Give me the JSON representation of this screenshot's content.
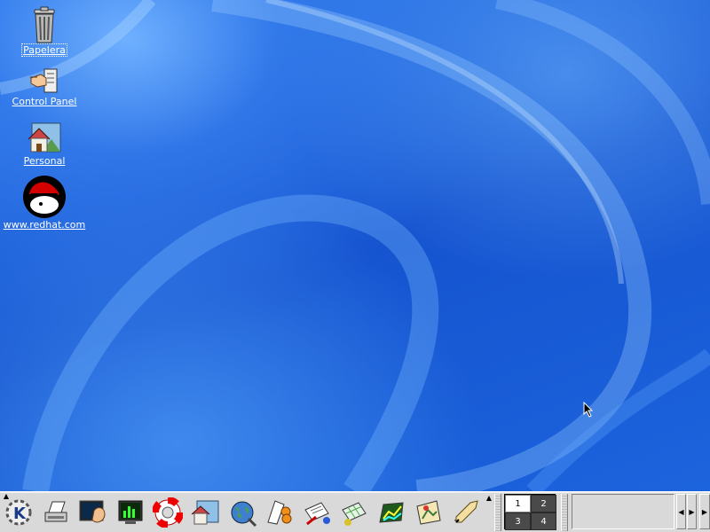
{
  "desktop": {
    "icons": [
      {
        "label": "Papelera",
        "icon": "trash-icon"
      },
      {
        "label": "Control Panel",
        "icon": "control-panel-icon"
      },
      {
        "label": "Personal",
        "icon": "home-folder-icon"
      },
      {
        "label": "www.redhat.com",
        "icon": "redhat-icon"
      }
    ]
  },
  "panel": {
    "launchers": [
      "kde-menu-icon",
      "printer-icon",
      "terminal-icon",
      "system-monitor-icon",
      "help-lifesaver-icon",
      "home-icon",
      "web-browser-icon",
      "mail-icon",
      "document-icon",
      "spreadsheet-icon",
      "chart-icon",
      "image-icon",
      "pen-icon"
    ],
    "pager": {
      "desktops": [
        "1",
        "2",
        "3",
        "4"
      ],
      "active": "1"
    }
  },
  "colors": {
    "desktop_bg": "#1b5fd6",
    "panel_bg": "#d9d9d9",
    "label_text": "#ffffff"
  }
}
